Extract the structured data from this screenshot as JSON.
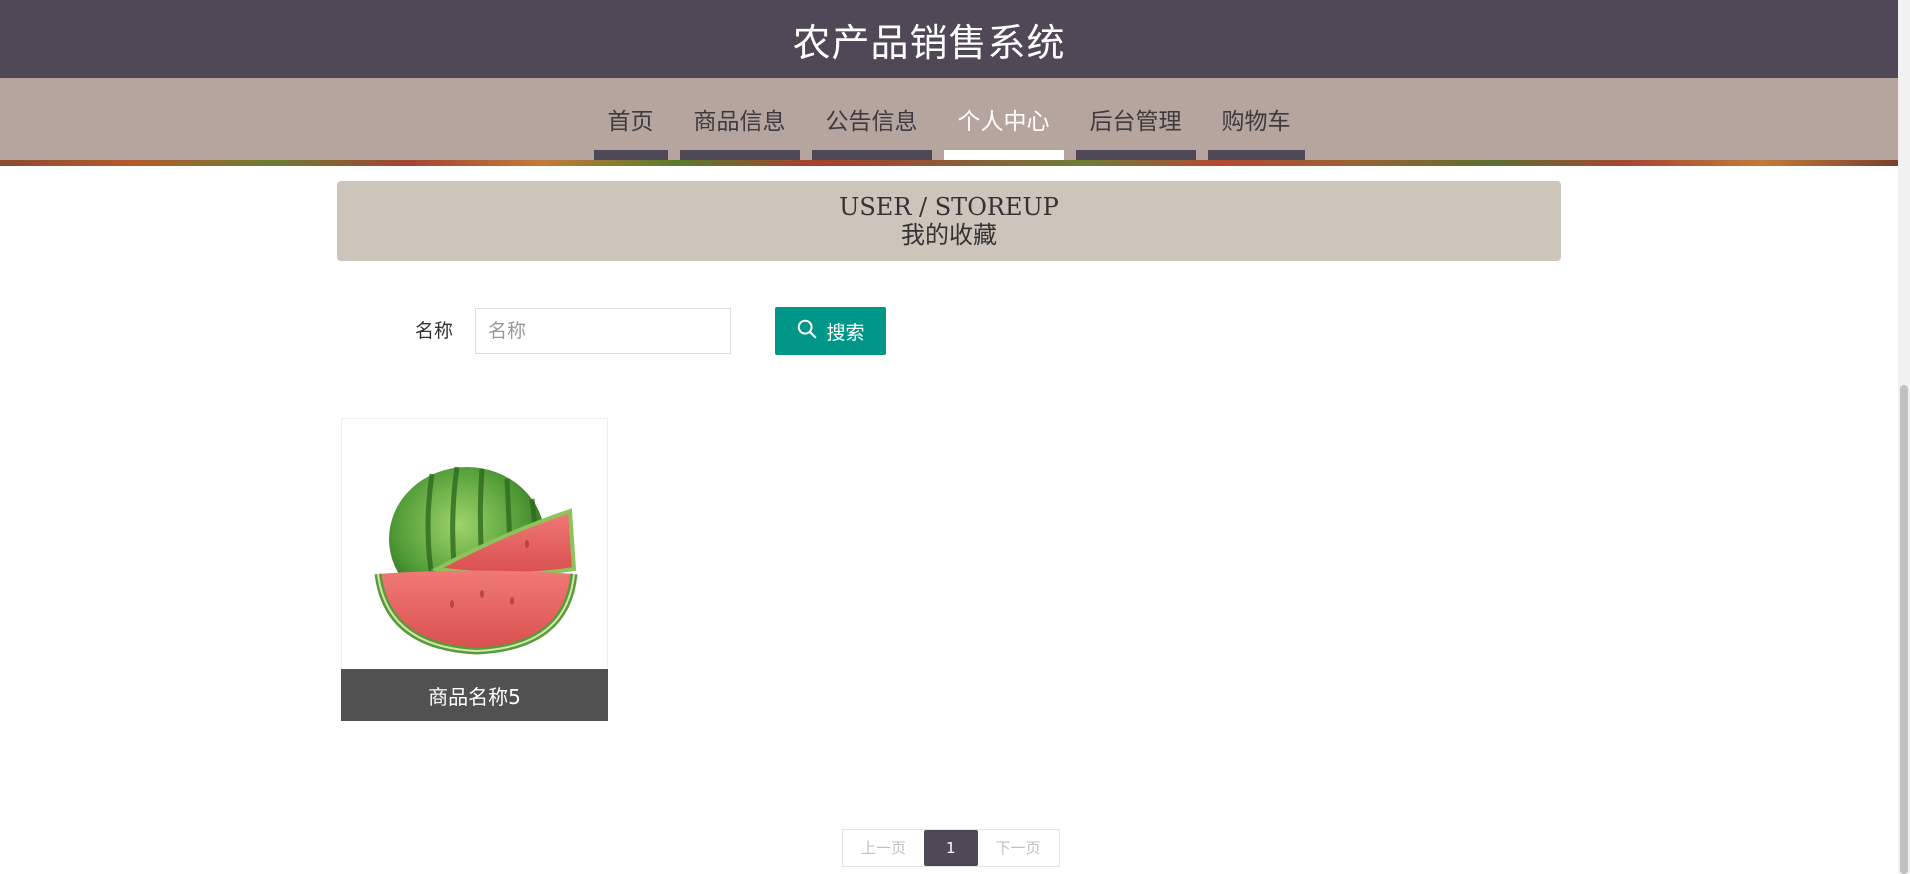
{
  "header": {
    "site_title": "农产品销售系统"
  },
  "nav": {
    "items": [
      {
        "label": "首页",
        "active": false
      },
      {
        "label": "商品信息",
        "active": false
      },
      {
        "label": "公告信息",
        "active": false
      },
      {
        "label": "个人中心",
        "active": true
      },
      {
        "label": "后台管理",
        "active": false
      },
      {
        "label": "购物车",
        "active": false
      }
    ]
  },
  "page_header": {
    "title_en": "USER / STOREUP",
    "title_cn": "我的收藏"
  },
  "search": {
    "label": "名称",
    "placeholder": "名称",
    "value": "",
    "button_label": "搜索",
    "button_icon": "search-icon"
  },
  "items": [
    {
      "name": "商品名称5",
      "image": "watermelon-image"
    }
  ],
  "pagination": {
    "prev_label": "上一页",
    "current_page": "1",
    "next_label": "下一页"
  },
  "colors": {
    "accent": "#009688",
    "brand": "#4f4856",
    "nav_bg": "#b5a59e",
    "header_band": "#cdc4bb"
  }
}
